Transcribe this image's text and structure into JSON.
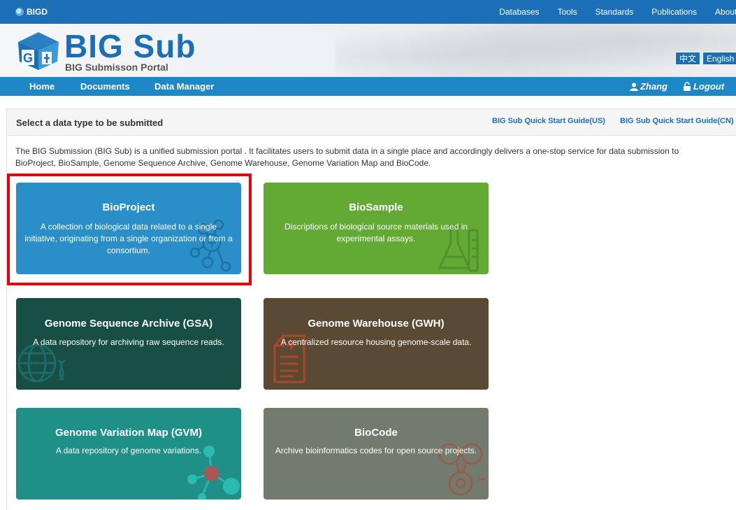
{
  "topbar": {
    "brand": "BIGD",
    "links": [
      "Databases",
      "Tools",
      "Standards",
      "Publications",
      "About"
    ]
  },
  "banner": {
    "title": "BIG Sub",
    "subtitle": "BIG Submisson Portal",
    "lang_cn": "中文",
    "lang_en": "English"
  },
  "mainnav": {
    "home": "Home",
    "documents": "Documents",
    "data_manager": "Data Manager",
    "user": "Zhang",
    "logout": "Logout"
  },
  "panel": {
    "title": "Select a data type to be submitted",
    "guide_us": "BIG Sub Quick Start Guide(US)",
    "guide_cn": "BIG Sub Quick Start Guide(CN)",
    "intro": "The BIG Submission (BIG Sub) is a unified submission portal . It facilitates users to submit data in a single place and accordingly delivers a one-stop service for data submission to BioProject, BioSample, Genome Sequence Archive, Genome Warehouse, Genome Variation Map and BioCode."
  },
  "cards": {
    "bioproject": {
      "title": "BioProject",
      "desc": "A collection of biological data related to a single initiative, originating from a single organization or from a consortium."
    },
    "biosample": {
      "title": "BioSample",
      "desc": "Discriptions of biological source materials used in experimental assays."
    },
    "gsa": {
      "title": "Genome Sequence Archive (GSA)",
      "desc": "A data repository for archiving raw sequence reads."
    },
    "gwh": {
      "title": "Genome Warehouse (GWH)",
      "desc": "A centralized resource housing genome-scale data."
    },
    "gvm": {
      "title": "Genome Variation Map (GVM)",
      "desc": "A data repository of genome variations."
    },
    "biocode": {
      "title": "BioCode",
      "desc": "Archive bioinformatics codes for open source projects."
    }
  },
  "colors": {
    "topbar": "#1a6fb6",
    "mainnav": "#1e88c7",
    "bioproject": "#2a8fc8",
    "biosample": "#62aa34",
    "gsa": "#184f44",
    "gwh": "#5b4a33",
    "gvm": "#1e9088",
    "biocode": "#737b6f",
    "highlight": "#e8000b"
  },
  "icons": {
    "brand": "bigd-logo-icon",
    "user": "user-icon",
    "logout": "lock-icon",
    "bioproject": "molecule-letters-icon",
    "biosample": "flask-icon",
    "gsa": "globe-dna-icon",
    "gwh": "document-icon",
    "gvm": "network-nodes-icon",
    "biocode": "code-circles-icon"
  }
}
